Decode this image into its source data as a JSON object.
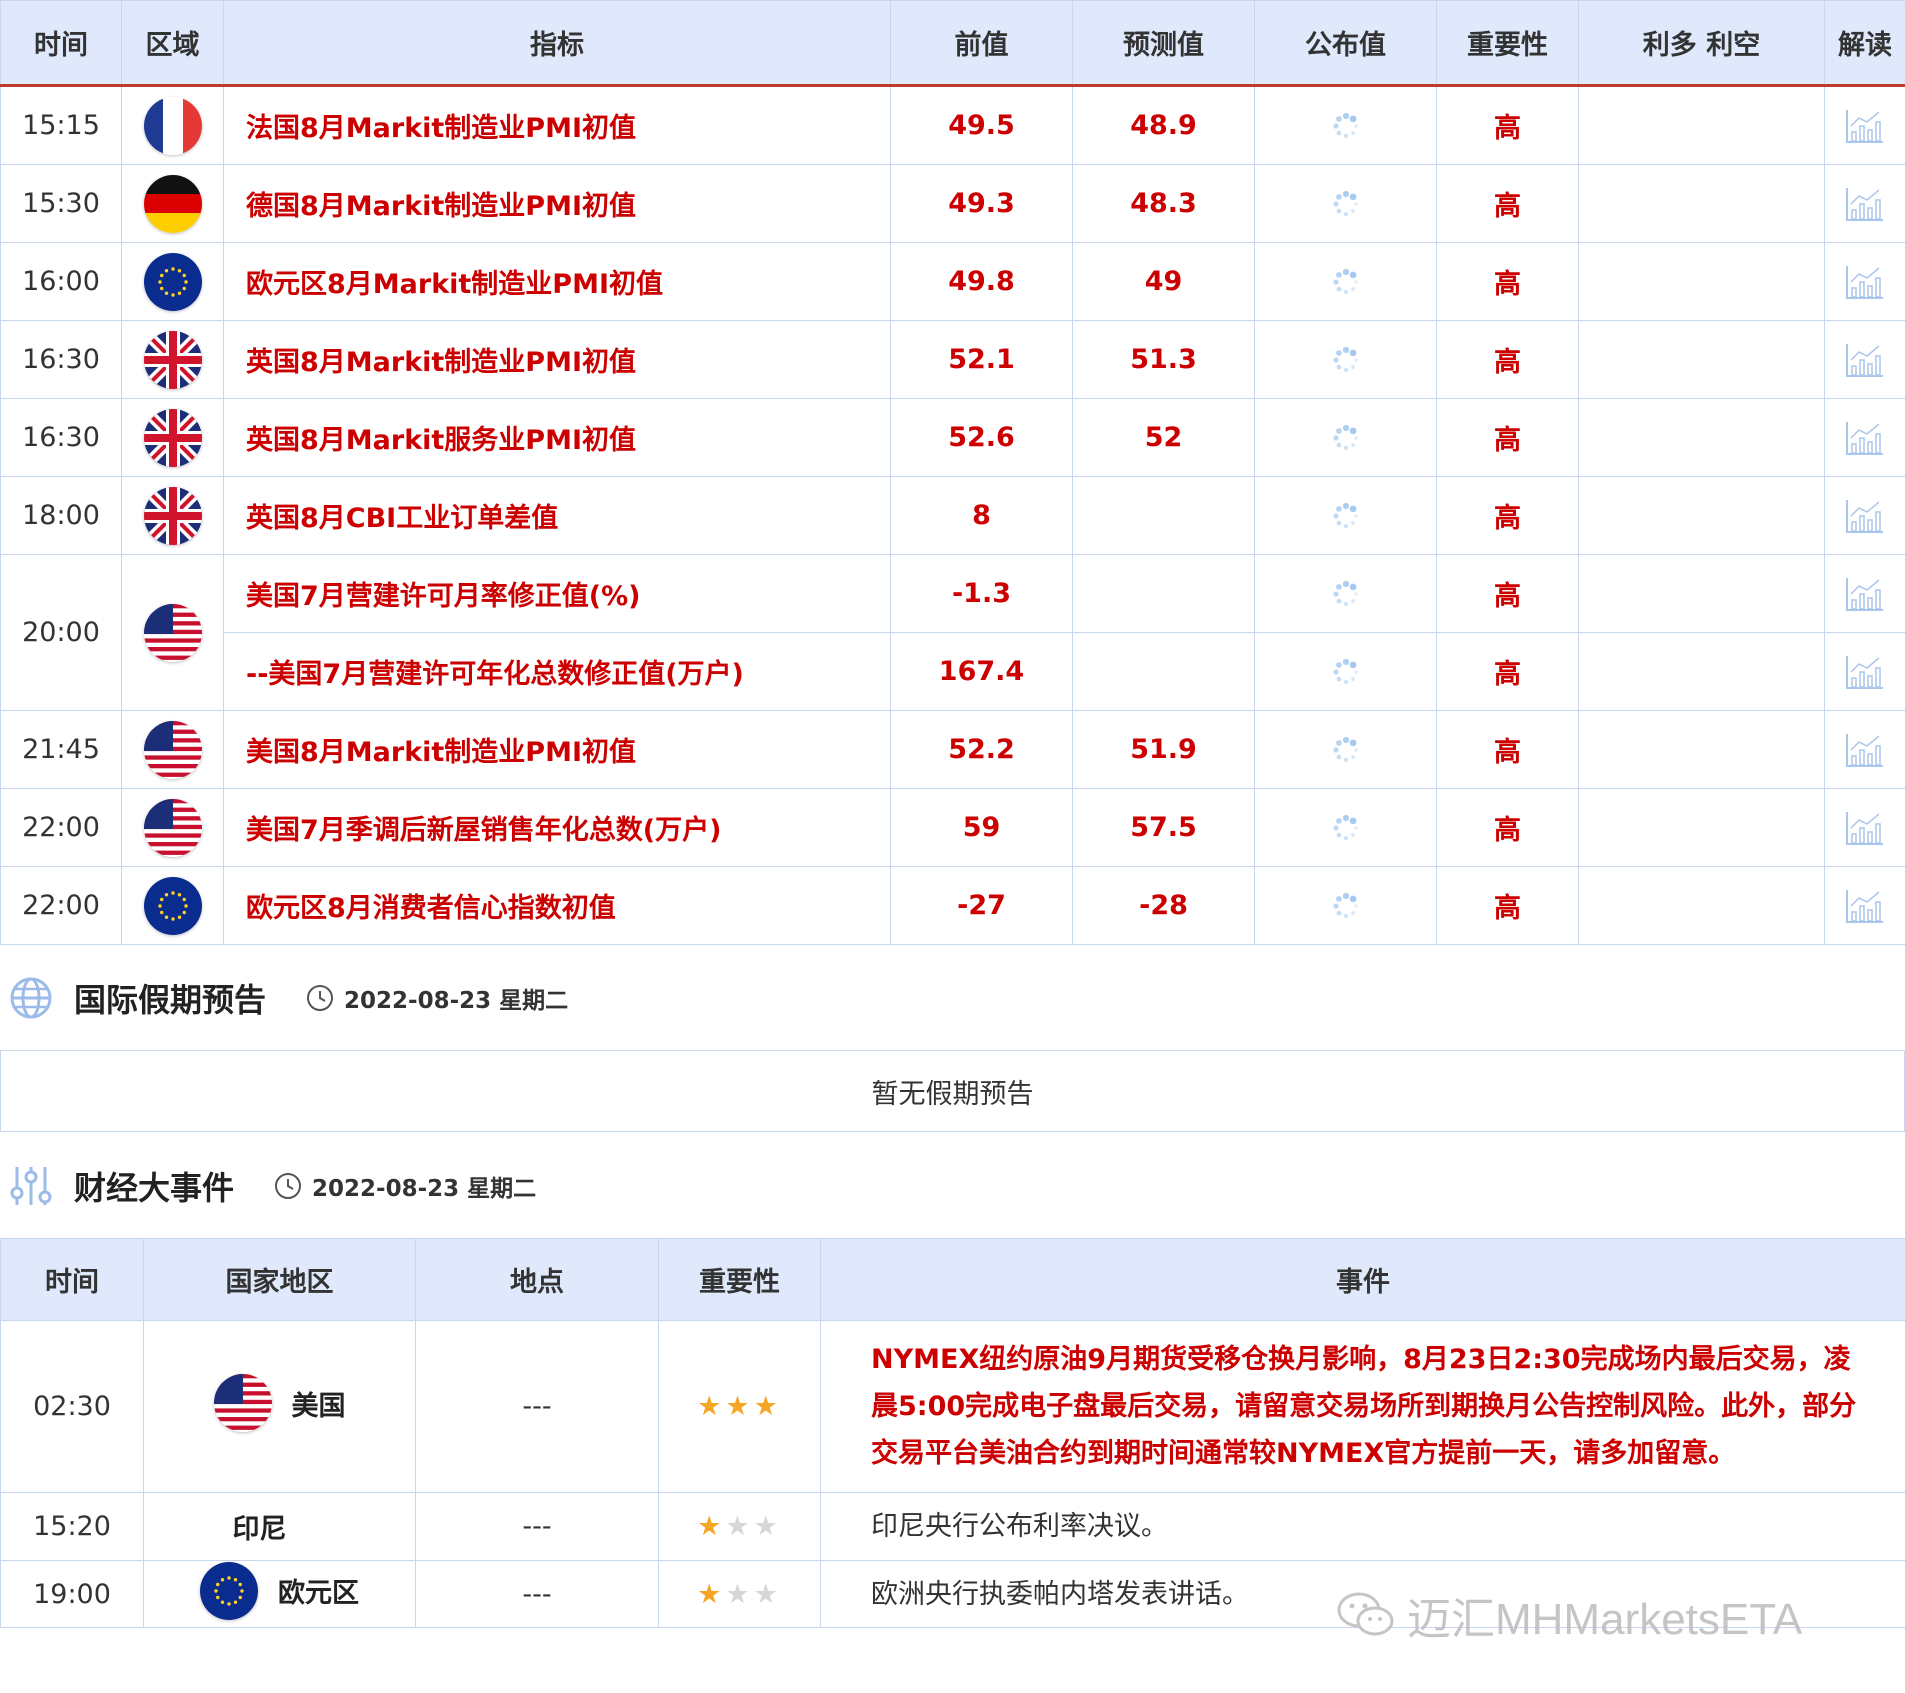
{
  "calendar": {
    "headers": [
      "时间",
      "区域",
      "指标",
      "前值",
      "预测值",
      "公布值",
      "重要性",
      "利多 利空",
      "解读"
    ],
    "rows": [
      {
        "time": "15:15",
        "flag": "fr",
        "indicator": "法国8月Markit制造业PMI初值",
        "prev": "49.5",
        "forecast": "48.9",
        "importance": "高"
      },
      {
        "time": "15:30",
        "flag": "de",
        "indicator": "德国8月Markit制造业PMI初值",
        "prev": "49.3",
        "forecast": "48.3",
        "importance": "高"
      },
      {
        "time": "16:00",
        "flag": "eu",
        "indicator": "欧元区8月Markit制造业PMI初值",
        "prev": "49.8",
        "forecast": "49",
        "importance": "高"
      },
      {
        "time": "16:30",
        "flag": "uk",
        "indicator": "英国8月Markit制造业PMI初值",
        "prev": "52.1",
        "forecast": "51.3",
        "importance": "高"
      },
      {
        "time": "16:30",
        "flag": "uk",
        "indicator": "英国8月Markit服务业PMI初值",
        "prev": "52.6",
        "forecast": "52",
        "importance": "高"
      },
      {
        "time": "18:00",
        "flag": "uk",
        "indicator": "英国8月CBI工业订单差值",
        "prev": "8",
        "forecast": "",
        "importance": "高"
      },
      {
        "time": "20:00",
        "flag": "us",
        "indicator": "美国7月营建许可月率修正值(%)",
        "prev": "-1.3",
        "forecast": "",
        "importance": "高"
      },
      {
        "time": "",
        "flag": "",
        "indicator": "--美国7月营建许可年化总数修正值(万户)",
        "prev": "167.4",
        "forecast": "",
        "importance": "高"
      },
      {
        "time": "21:45",
        "flag": "us",
        "indicator": "美国8月Markit制造业PMI初值",
        "prev": "52.2",
        "forecast": "51.9",
        "importance": "高"
      },
      {
        "time": "22:00",
        "flag": "us",
        "indicator": "美国7月季调后新屋销售年化总数(万户)",
        "prev": "59",
        "forecast": "57.5",
        "importance": "高"
      },
      {
        "time": "22:00",
        "flag": "eu",
        "indicator": "欧元区8月消费者信心指数初值",
        "prev": "-27",
        "forecast": "-28",
        "importance": "高"
      }
    ]
  },
  "holiday": {
    "title": "国际假期预告",
    "date": "2022-08-23 星期二",
    "empty_text": "暂无假期预告"
  },
  "events": {
    "title": "财经大事件",
    "date": "2022-08-23 星期二",
    "headers": [
      "时间",
      "国家地区",
      "地点",
      "重要性",
      "事件"
    ],
    "rows": [
      {
        "time": "02:30",
        "flag": "us",
        "country": "美国",
        "place": "---",
        "stars": 3,
        "text": "NYMEX纽约原油9月期货受移仓换月影响，8月23日2:30完成场内最后交易，凌晨5:00完成电子盘最后交易，请留意交易场所到期换月公告控制风险。此外，部分交易平台美油合约到期时间通常较NYMEX官方提前一天，请多加留意。",
        "highlight": true
      },
      {
        "time": "15:20",
        "flag": "",
        "country": "印尼",
        "place": "---",
        "stars": 1,
        "text": "印尼央行公布利率决议。",
        "highlight": false
      },
      {
        "time": "19:00",
        "flag": "eu",
        "country": "欧元区",
        "place": "---",
        "stars": 1,
        "text": "欧洲央行执委帕内塔发表讲话。",
        "highlight": false
      }
    ]
  },
  "watermark": "迈汇MHMarketsETA",
  "colors": {
    "accent_red": "#cc0000",
    "header_bg": "#dfe9fb",
    "border": "#c9d7ee",
    "star": "#f5a623"
  }
}
